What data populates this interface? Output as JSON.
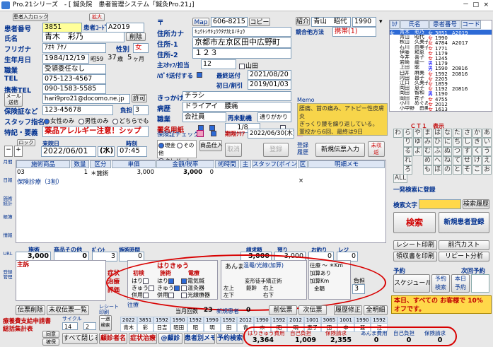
{
  "window": {
    "app": "Pro.21シリーズ",
    "title": "- [ 鍼灸院　患者管理システム「鍼灸Pro.21」]",
    "minimize": "－",
    "maximize": "□",
    "close": "×"
  },
  "toolbar": {
    "patient_card": "患者入力ロック",
    "enlarge": "拡大",
    "search_kana": "カナ",
    "patient_list": "患者一覧",
    "code": "コード"
  },
  "patient": {
    "number_label": "患者番号",
    "number": "3851",
    "code_label": "患者ｺｰﾄﾞ",
    "code": "A2019",
    "name_label": "氏名",
    "name": "青木　彩乃",
    "delete": "削除",
    "kana_label": "フリガナ",
    "kana": "ｱｵｷ ｱﾔﾉ",
    "sex_label": "性別",
    "sex": "女",
    "birth_label": "生年月日",
    "birth": "1984/12/19",
    "era": "昭59",
    "age": "37",
    "age_unit": "歳",
    "months": "5",
    "month_unit": "ヶ月",
    "status_label": "職業",
    "status": "受領委任なし",
    "tel_label": "TEL",
    "tel": "075-123-4567",
    "mobile_label": "携帯TEL",
    "mobile": "090-1583-5585",
    "mail_label": "メール\n送信",
    "email": "hari9pro21@docomo.ne.jp",
    "permit": "許可",
    "insurance_label": "保険証など",
    "insurance": "123-45678",
    "burden_label": "負担",
    "burden": "3",
    "staff_label": "スタッフ指名",
    "staff_opt1": "女性のみ",
    "staff_opt2": "男性のみ",
    "staff_opt3": "どちらでも",
    "notes_label": "特記・要義",
    "notes": "薬品アレルギー注意！シップ"
  },
  "address": {
    "zip_label": "〒",
    "map": "Map",
    "zip": "606-8215",
    "copy": "コピー",
    "kana_label": "住所カナ",
    "kana": "ｷｮｳﾄｼｻｷｮｳｸﾀﾅｶﾋﾛﾉﾁｮｳ",
    "addr1_label": "住所-1",
    "addr1": "京都市左京区田中広野町",
    "addr2_label": "住所-2",
    "addr2": "１２３",
    "staff_label": "主ｽﾀｯﾌ/担当",
    "staff": "12",
    "staff_name": "山田",
    "send_label": "ﾊｶﾞｷ送付する",
    "last_visit_label": "最終送付",
    "last_visit": "2021/08/20",
    "first_label": "初日/割引",
    "first": "2019/01/03",
    "trigger_label": "きっかけ",
    "trigger": "チラシ",
    "history_label": "病歴",
    "history": "ドライアイ　腰痛",
    "job_label": "職業",
    "job": "会社員",
    "treat_label": "再来動機",
    "treat": "通りがかり",
    "sign_label": "署名用紙",
    "sign_count": "1/8",
    "insurance_check": "保険証チェック",
    "period_label": "期限ｸﾘｱ",
    "period": "2022/06/30(木)"
  },
  "referral": {
    "label": "紹介",
    "name": "青山　昭代",
    "code": "1990",
    "group_label": "競合他方法",
    "group": "携帯(1)"
  },
  "memo": {
    "label": "Memo",
    "text": "腰痛、首の痛み、アトピー性皮膚炎\nぎっくり腰を繰り返している。\n董校から6回、最終は9日"
  },
  "list_header": {
    "col1": "ｶﾅ",
    "col2": "氏名",
    "col3": "患者番号",
    "col4": "コード"
  },
  "patients": [
    {
      "sex": "女",
      "name": "青木　彩乃",
      "sex2": "女",
      "no": "3851",
      "code": "A2019",
      "sel": true
    },
    {
      "sex": "",
      "name": "青山　昭代",
      "sex2": "女",
      "no": "1990",
      "code": "",
      "sel": false
    },
    {
      "sex": "",
      "name": "秋山　久美子",
      "sex2": "女",
      "no": "4784",
      "code": "A2017",
      "sel": false
    },
    {
      "sex": "",
      "name": "石川　由美子",
      "sex2": "女",
      "no": "1771",
      "code": "",
      "sel": false
    },
    {
      "sex": "",
      "name": "伊藤　和恵",
      "sex2": "女",
      "no": "1179",
      "code": "",
      "sel": false
    },
    {
      "sex": "",
      "name": "今井　喜子",
      "sex2": "女",
      "no": "1245",
      "code": "",
      "sel": false
    },
    {
      "sex": "",
      "name": "岩崎　龍一",
      "sex2": "男",
      "no": "1179",
      "code": "",
      "sel": false
    },
    {
      "sex": "",
      "name": "上田　聡",
      "sex2": "男",
      "no": "1590",
      "code": "20816",
      "sel": false
    },
    {
      "sex": "",
      "name": "臼井　麻美",
      "sex2": "女",
      "no": "1592",
      "code": "20816",
      "sel": false
    },
    {
      "sex": "",
      "name": "内田　昌子",
      "sex2": "女",
      "no": "2205",
      "code": "",
      "sel": false
    },
    {
      "sex": "",
      "name": "江口　久美子",
      "sex2": "女",
      "no": "1859",
      "code": "",
      "sel": false
    },
    {
      "sex": "",
      "name": "岡田　恵子",
      "sex2": "女",
      "no": "1192",
      "code": "20816",
      "sel": false
    },
    {
      "sex": "",
      "name": "岡田　智和",
      "sex2": "男",
      "no": "1190",
      "code": "",
      "sel": false
    },
    {
      "sex": "",
      "name": "岡田　花子",
      "sex2": "女",
      "no": "4755",
      "code": "",
      "sel": false
    },
    {
      "sex": "",
      "name": "小川　めぐみ",
      "sex2": "女",
      "no": "2012",
      "code": "",
      "sel": false
    },
    {
      "sex": "",
      "name": "小中野　由美子",
      "sex2": "女",
      "no": "1613",
      "code": "",
      "sel": false
    }
  ],
  "kana_grid": {
    "nav": "ＣＴ１　表示",
    "rows": [
      [
        "わ",
        "ら",
        "や",
        "ま",
        "は",
        "な",
        "た",
        "さ",
        "か",
        "あ"
      ],
      [
        "",
        "り",
        "ゆ",
        "み",
        "ひ",
        "に",
        "ち",
        "し",
        "き",
        "い"
      ],
      [
        "",
        "る",
        "よ",
        "む",
        "ふ",
        "ぬ",
        "つ",
        "す",
        "く",
        "う"
      ],
      [
        "",
        "れ",
        "",
        "め",
        "へ",
        "ね",
        "て",
        "せ",
        "け",
        "え"
      ],
      [
        "",
        "ろ",
        "",
        "も",
        "ほ",
        "の",
        "と",
        "そ",
        "こ",
        "お"
      ]
    ],
    "all": "ALL"
  },
  "search": {
    "bulk_register": "一発検索に登録",
    "label": "検索文字",
    "history": "検索履歴",
    "search_btn": "検索",
    "new_btn": "新規患者登録"
  },
  "receipt": {
    "print": "レシート印刷",
    "prev": "前汽カスト",
    "sheet_print": "領収書を印刷",
    "repeat": "リピート分析"
  },
  "reserve": {
    "label": "予約",
    "next": "次回予約",
    "schedule": "スケジュール",
    "reserve_search": "予約\n検索",
    "today": "本日\n予約"
  },
  "notice": "本日、すべての お客様で 10%オフです。",
  "visit": {
    "lock": "ロック",
    "date_label": "来院日",
    "date": "2022/06/01",
    "weekday": "(水)",
    "time_label": "時刻",
    "time": "07:45",
    "opt_new": "現金",
    "opt_credit": "その他",
    "opt_card": "クレジット",
    "product_btn": "商品仕入",
    "fixed": "取消",
    "register": "登録",
    "history": "登録\n履歴",
    "new_slip": "新規伝票入力",
    "unpaid": "未収\n返"
  },
  "slip_header": {
    "c1": "施術商品",
    "c2": "数量",
    "c3": "区分",
    "c4": "単価",
    "c5": "金額/税率",
    "c6": "術時間",
    "c7": "主",
    "c8": "スタッフ(ポイント)",
    "c9": "区",
    "c10": "明細メモ"
  },
  "slip_rows": [
    {
      "code": "03",
      "qty": "1",
      "type": "＊施術",
      "price": "3,000",
      "amount": "3,000",
      "rate": "0",
      "time": "",
      "staff": "",
      "sub": ""
    },
    {
      "code": "保険診療（3割）",
      "qty": "",
      "type": "",
      "price": "",
      "amount": "",
      "rate": "",
      "time": "",
      "staff": "",
      "sub": "×"
    }
  ],
  "slip_footer": {
    "treat_label": "施術",
    "treat": "3,000",
    "product_label": "商品その他",
    "product": "0",
    "point_label": "ﾎﾟｲﾝﾄ",
    "point": "3",
    "time_label": "施術時間",
    "time": "0",
    "total_label": "請求額",
    "total": "3,000",
    "received_label": "預り",
    "received": "3,000",
    "change_label": "お釣り",
    "change": "0",
    "reg_label": "レジ",
    "reg": "0"
  },
  "main": {
    "label": "主訴",
    "symptom": "症状",
    "treatment": "治療",
    "evaluation": "評価"
  },
  "treat_area": {
    "title": "はりきゅう",
    "cat1": "初検",
    "cat2": "施術",
    "cat3": "電療",
    "hari": "はり",
    "kyu": "きゅう",
    "both": "併用",
    "electric": "電気鍼",
    "warm": "温灸器",
    "light": "光線療器",
    "anma": "あんま",
    "hot": "温罨/光線(加算)",
    "far": "往療 〜 ＊Km",
    "extra": "加算あり",
    "km": "加算Km",
    "deform": "変形徒手矯正術",
    "upper_left": "左上",
    "upper_right": "右上",
    "body": "躯幹",
    "lower_left": "左下",
    "lower_right": "右下",
    "amount": "金額",
    "burden_label": "負担",
    "burden": "3",
    "visit_label": "往療"
  },
  "bottom": {
    "slip_delete": "伝票削除",
    "unpaid_list": "未収伝票一覧",
    "receipt": "レシート\n印刷",
    "count_label": "当月回数",
    "count": "23",
    "new_count_label": "新規患者",
    "new_count": "0",
    "prev_slip": "前伝票",
    "next_slip": "次伝票",
    "history": "履歴修正",
    "all_detail": "全明細"
  },
  "ledger": {
    "header": [
      "2022",
      "3851",
      "1592",
      "1990",
      "1592",
      "1990",
      "1592",
      "2012",
      "1990",
      "1592",
      "2012",
      "1001",
      "3065",
      "1001",
      "1990",
      "1592"
    ],
    "names": [
      "青木",
      "彩",
      "日吉",
      "昭田",
      "昭",
      "明",
      "田",
      "青",
      "木",
      "昭",
      "明",
      "恵子",
      "田",
      "中",
      "亜",
      "江"
    ]
  },
  "sidebar_links": [
    "療養費支給申請書",
    "総括集計表"
  ],
  "stats": {
    "cycle_label": "サイクル",
    "cycle": "14",
    "cycle2": "2",
    "visit_week": "一週\n検索"
  },
  "footer_buttons": {
    "agree": "同意",
    "print": "被保",
    "close_all": "すべて閉じる",
    "tag_print": "顧診者名",
    "disease": "症状治療",
    "sign_print": "@顧診",
    "patient_list": "患者別メモ",
    "reserve_list": "予約検索"
  },
  "totals": {
    "hari_label": "はりきゅう費用",
    "hari": "3,364",
    "self_label": "自己負担",
    "self": "1,009",
    "claim_label": "保険請求",
    "claim": "2,355",
    "anma_label": "あんま費用",
    "anma": "0",
    "anma_self_label": "自己負担",
    "anma_self": "0",
    "anma_claim_label": "保険請求",
    "anma_claim": "0"
  },
  "side_left": [
    "月間",
    "日報",
    "施術統計",
    "帳簿",
    "情報",
    "URL",
    "登録\n管理"
  ],
  "colors": {
    "accent": "#00308f",
    "highlight": "#ffff99",
    "alert": "#d80000",
    "memo": "#f7d54a",
    "selection": "#2d6ad6",
    "notice": "#ffd84a"
  }
}
